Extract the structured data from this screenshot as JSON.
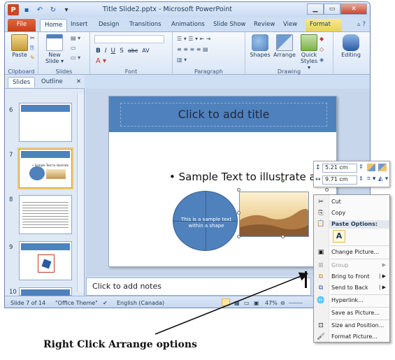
{
  "titlebar": {
    "title": "Title Slide2.pptx - Microsoft PowerPoint",
    "minimize": "▁",
    "maximize": "▭",
    "close": "✕"
  },
  "tabs": [
    "File",
    "Home",
    "Insert",
    "Design",
    "Transitions",
    "Animations",
    "Slide Show",
    "Review",
    "View",
    "Format"
  ],
  "ribbon": {
    "clipboard": {
      "paste": "Paste",
      "group": "Clipboard"
    },
    "slides": {
      "new_slide": "New Slide ▾",
      "group": "Slides"
    },
    "font": {
      "group": "Font",
      "buttons": [
        "B",
        "I",
        "U",
        "S",
        "abc",
        "AV"
      ]
    },
    "paragraph": {
      "group": "Paragraph"
    },
    "drawing": {
      "shapes": "Shapes",
      "arrange": "Arrange",
      "quick_styles": "Quick Styles ▾",
      "group": "Drawing"
    },
    "editing": {
      "label": "Editing"
    }
  },
  "left_pane": {
    "tabs": [
      "Slides",
      "Outline"
    ],
    "close": "✕",
    "thumbnails": [
      {
        "number": "6"
      },
      {
        "number": "7",
        "text": "• Sample Text to illustrate"
      },
      {
        "number": "8"
      },
      {
        "number": "9"
      },
      {
        "number": "10"
      }
    ]
  },
  "slide": {
    "title": "Click to add title",
    "bullet": "• Sample Text to illustrate a           rt",
    "shape_text": "This is a sample text within a shape"
  },
  "notes": {
    "placeholder": "Click to add notes"
  },
  "statusbar": {
    "slide": "Slide 7 of 14",
    "theme": "\"Office Theme\"",
    "language": "English (Canada)",
    "zoom": "47%"
  },
  "mini_toolbar": {
    "height": "5.21 cm",
    "width": "9.71 cm"
  },
  "context_menu": {
    "items": [
      {
        "label": "Cut",
        "icon": "scissors-icon",
        "glyph": "✂",
        "enabled": true
      },
      {
        "label": "Copy",
        "icon": "copy-icon",
        "glyph": "⎘",
        "enabled": true
      },
      {
        "label": "Paste Options:",
        "icon": "paste-icon",
        "glyph": "📋",
        "enabled": true
      },
      {
        "label": "Change Picture...",
        "icon": "picture-icon",
        "glyph": "▣",
        "enabled": true
      },
      {
        "label": "Group",
        "icon": "group-icon",
        "glyph": "⊞",
        "enabled": false
      },
      {
        "label": "Bring to Front",
        "icon": "bring-front-icon",
        "glyph": "⧉",
        "enabled": true
      },
      {
        "label": "Send to Back",
        "icon": "send-back-icon",
        "glyph": "⧉",
        "enabled": true
      },
      {
        "label": "Hyperlink...",
        "icon": "hyperlink-icon",
        "glyph": "🌐",
        "enabled": true
      },
      {
        "label": "Save as Picture...",
        "icon": "save-picture-icon",
        "glyph": " ",
        "enabled": true
      },
      {
        "label": "Size and Position...",
        "icon": "size-position-icon",
        "glyph": "⊡",
        "enabled": true
      },
      {
        "label": "Format Picture...",
        "icon": "format-picture-icon",
        "glyph": "🖌",
        "enabled": true
      }
    ],
    "paste_option": "A"
  },
  "caption": "Right Click Arrange options",
  "colors": {
    "accent": "#4f81bd",
    "file_tab": "#c2411c",
    "format_tab": "#e9d35b"
  }
}
